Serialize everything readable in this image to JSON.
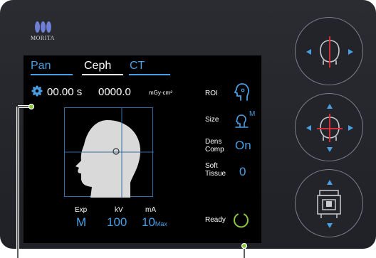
{
  "brand": {
    "name": "MORITA"
  },
  "tabs": [
    {
      "label": "Pan",
      "state": "inactive"
    },
    {
      "label": "Ceph",
      "state": "active"
    },
    {
      "label": "CT",
      "state": "inactive"
    }
  ],
  "readout": {
    "time": "00.00 s",
    "dose": "0000.0",
    "dose_unit": "mGy·cm²"
  },
  "params": {
    "exp": {
      "label": "Exp",
      "value": "M"
    },
    "kv": {
      "label": "kV",
      "value": "100"
    },
    "ma": {
      "label": "mA",
      "value": "10",
      "sub": "Max"
    }
  },
  "settings": {
    "roi": {
      "label": "ROI"
    },
    "size": {
      "label": "Size",
      "value": "M"
    },
    "dens": {
      "label_line1": "Dens",
      "label_line2": "Comp",
      "value": "On"
    },
    "soft": {
      "label_line1": "Soft",
      "label_line2": "Tissue",
      "value": "0"
    }
  },
  "status": {
    "text": "Ready"
  },
  "icons": [
    "settings-gear-icon",
    "head-profile-icon",
    "roi-head-icon",
    "size-person-icon",
    "ready-ring-icon",
    "head-front-adjust-icon",
    "head-crosshair-adjust-icon",
    "patient-positioning-icon"
  ],
  "colors": {
    "accent": "#4a9fe3",
    "panel": "#26282d",
    "screen": "#000000",
    "callout": "#8dc63f",
    "marker": "#d0303a"
  }
}
